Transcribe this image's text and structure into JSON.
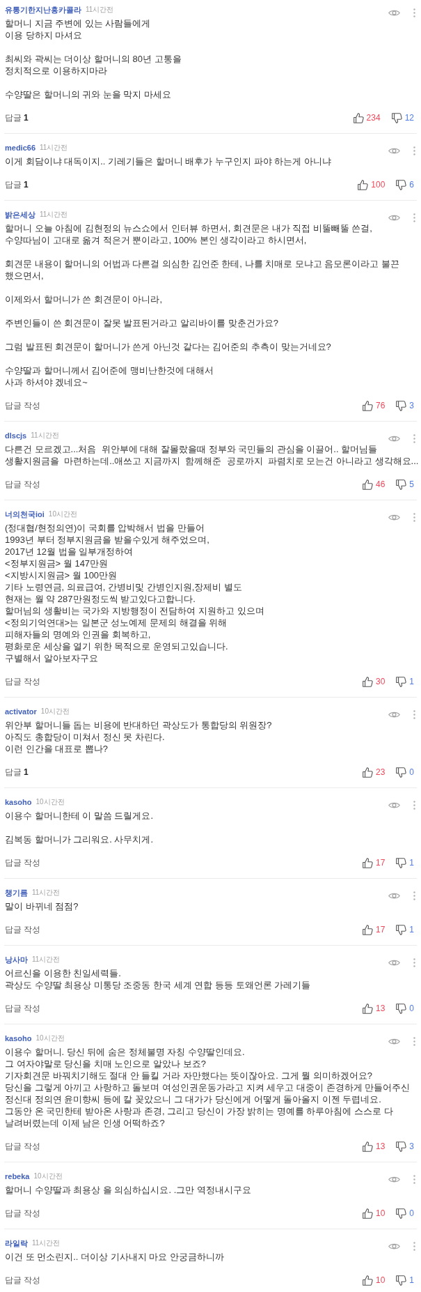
{
  "comments": [
    {
      "author": "유통기한지난홍카콜라",
      "time": "11시간전",
      "body": "할머니 지금 주변에 있는 사람들에게\n이용 당하지 마셔요\n\n최씨와 곽씨는 더이상 할머니의 80년 고통을\n정치적으로 이용하지마라\n\n수양딸은 할머니의 귀와 눈을 막지 마세요",
      "reply": {
        "label": "답글",
        "count": "1"
      },
      "likes": "234",
      "dislikes": "12"
    },
    {
      "author": "medic66",
      "time": "11시간전",
      "body": "이게 회담이냐 대독이지.. 기레기들은 할머니 배후가 누구인지 파야 하는게 아니냐",
      "reply": {
        "label": "답글",
        "count": "1"
      },
      "likes": "100",
      "dislikes": "6"
    },
    {
      "author": "밝은세상",
      "time": "11시간전",
      "body": "할머니 오늘 아침에 김현정의 뉴스쇼에서 인터뷰 하면서, 회견문은 내가 직접 비뚤빼뚤 쓴걸,\n수양따님이 고대로 옮겨 적은거 뿐이라고, 100% 본인 생각이라고 하시면서,\n\n회견문 내용이 할머니의 어법과 다른걸 의심한 김언준 한테, 나를 치매로 모냐고 음모론이라고 불끈\n했으면서,\n\n이제와서 할머니가 쓴 회견문이 아니라,\n\n주변인들이 쓴 회견문이 잘못 발표된거라고 알리바이를 맞춘건가요?\n\n그럼 발표된 회견문이 할머니가 쓴게 아닌것 같다는 김어준의 추측이 맞는거네요?\n\n수양딸과 할머니께서 김어준에 맹비난한것에 대해서\n사과 하셔야 겠네요~",
      "reply": {
        "label": "답글 작성"
      },
      "likes": "76",
      "dislikes": "3"
    },
    {
      "author": "dlscjs",
      "time": "11시간전",
      "body": "다른건 모르겠고...처음  위안부에 대해 잘몰랐을때 정부와 국민들의 관심을 이끌어.. 할머님들\n생활지원금을  마련하는데..애쓰고 지금까지  함께해준  공로까지  파렴치로 모는건 아니라고 생각해요...",
      "reply": {
        "label": "답글 작성"
      },
      "likes": "46",
      "dislikes": "5"
    },
    {
      "author": "너의천국ioi",
      "time": "10시간전",
      "body": "(정대협/현정의연)이 국회를 압박해서 법을 만들어\n1993년 부터 정부지원금을 받을수있게 해주었으며,\n2017년 12월 법을 일부개정하여\n<정부지원금> 월 147만원\n<지방시지원금> 월 100만원\n기타 노령연금, 의료급여, 간병비및 간병인지원,장제비 별도\n현재는 월 약 287만원정도씩 받고있다고합니다.\n할머님의 생활비는 국가와 지방행정이 전담하여 지원하고 있으며\n<정의기억연대>는 일본군 성노예제 문제의 해결을 위해\n피해자들의 명예와 인권을 회복하고,\n평화로운 세상을 열기 위한 목적으로 운영되고있습니다.\n구별해서 알아보자구요",
      "reply": {
        "label": "답글 작성"
      },
      "likes": "30",
      "dislikes": "1"
    },
    {
      "author": "activator",
      "time": "10시간전",
      "body": "위안부 할머니들 돕는 비용에 반대하던 곽상도가 통합당의 위원장?\n아직도 총합당이 미쳐서 정신 못 차린다.\n이런 인간을 대표로 뽑나?",
      "reply": {
        "label": "답글",
        "count": "1"
      },
      "likes": "23",
      "dislikes": "0"
    },
    {
      "author": "kasoho",
      "time": "10시간전",
      "body": "이용수 할머니한테 이 말씀 드릴게요.\n\n김복동 할머니가 그리워요. 사무치게.",
      "reply": {
        "label": "답글 작성"
      },
      "likes": "17",
      "dislikes": "1"
    },
    {
      "author": "챙기름",
      "time": "11시간전",
      "body": "말이 바뀌네 점점?",
      "reply": {
        "label": "답글 작성"
      },
      "likes": "17",
      "dislikes": "1"
    },
    {
      "author": "낭사마",
      "time": "11시간전",
      "body": "어르신을 이용한 친일세력들.\n곽상도 수양딸 최용상 미통당 조중동 한국 세계 연합 등등 토왜언론 가레기들",
      "reply": {
        "label": "답글 작성"
      },
      "likes": "13",
      "dislikes": "0"
    },
    {
      "author": "kasoho",
      "time": "10시간전",
      "body": "이용수 할머니. 당신 뒤에 숨은 정체불명 자칭 수양딸인데요.\n그 여자야말로 당신을 치매 노인으로 알았나 보죠?\n기자회견문 바꿔치기해도 절대 안 들킬 거라 자만했다는 뜻이잖아요. 그게 뭘 의미하겠어요?\n당신을 그렇게 아끼고 사랑하고 돌보며 여성인권운동가라고 지켜 세우고 대중이 존경하게 만들어주신\n정신대 정의연 윤미향씨 등에 칼 꽂았으니 그 대가가 당신에게 어떻게 돌아올지 이젠 두렵네요.\n그동안 온 국민한테 받아온 사랑과 존경, 그리고 당신이 가장 밝히는 명예를 하루아침에 스스로 다\n날려버렸는데 이제 남은 인생 어떡하죠?",
      "reply": {
        "label": "답글 작성"
      },
      "likes": "13",
      "dislikes": "3"
    },
    {
      "author": "rebeka",
      "time": "10시간전",
      "body": "할머니 수양딸과 최용상 을 의심하십시요. .그만 역정내시구요",
      "reply": {
        "label": "답글 작성"
      },
      "likes": "10",
      "dislikes": "0"
    },
    {
      "author": "라일락",
      "time": "11시간전",
      "body": "이건 또 먼소린지.. 더이상 기사내지 마요 안궁금하니까",
      "reply": {
        "label": "답글 작성"
      },
      "likes": "10",
      "dislikes": "1"
    }
  ]
}
